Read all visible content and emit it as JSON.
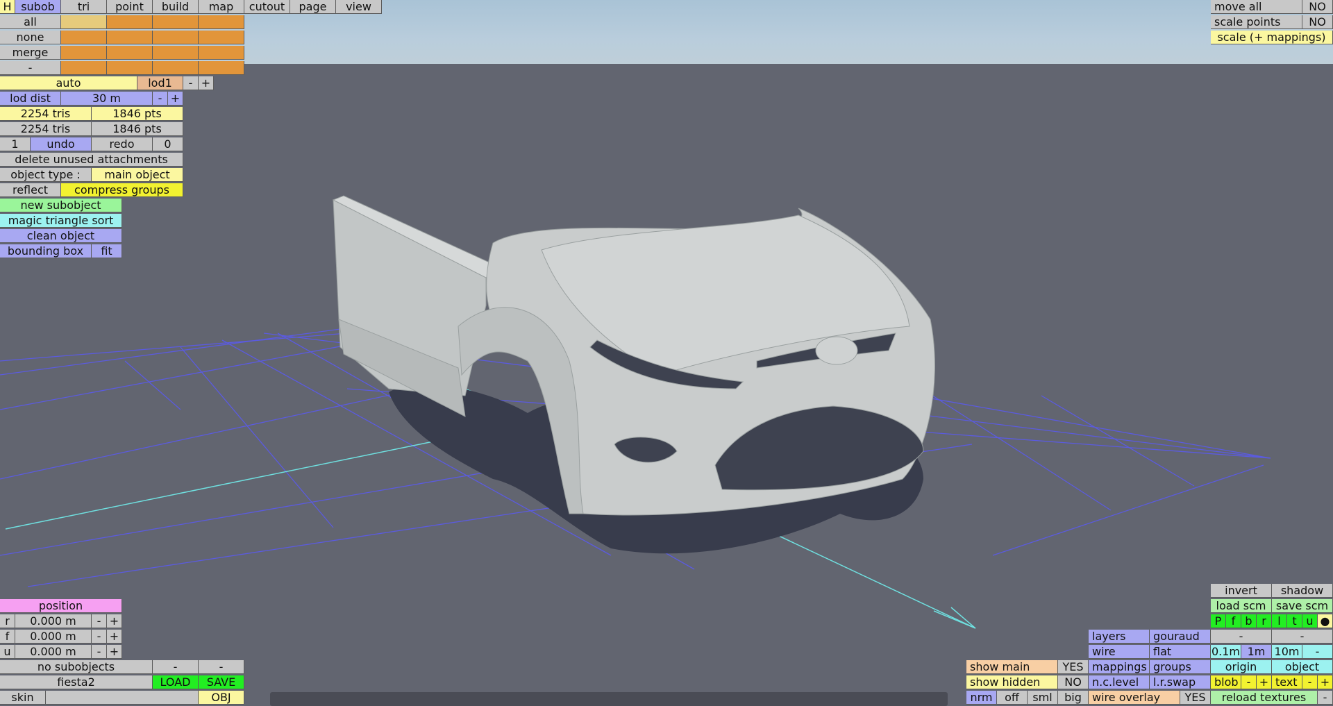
{
  "top_menu": {
    "h": "H",
    "tabs": [
      "subob",
      "tri",
      "point",
      "build",
      "map",
      "cutout",
      "page",
      "view"
    ]
  },
  "selection": {
    "all": "all",
    "none": "none",
    "merge": "merge",
    "minus": "-"
  },
  "lod": {
    "auto": "auto",
    "lod1": "lod1",
    "minus": "-",
    "plus": "+",
    "dist_label": "lod dist",
    "dist_value": "30 m"
  },
  "stats": {
    "row1_tris": "2254 tris",
    "row1_pts": "1846 pts",
    "row2_tris": "2254 tris",
    "row2_pts": "1846 pts"
  },
  "history": {
    "undo_count": "1",
    "undo": "undo",
    "redo": "redo",
    "redo_count": "0"
  },
  "object_panel": {
    "delete_unused": "delete unused attachments",
    "object_type_label": "object type :",
    "object_type_value": "main object",
    "reflect": "reflect",
    "compress_groups": "compress groups",
    "new_subobject": "new subobject",
    "magic_sort": "magic triangle sort",
    "clean_object": "clean object",
    "bounding_box": "bounding box",
    "fit": "fit"
  },
  "top_right": {
    "move_all": "move all",
    "move_all_value": "NO",
    "scale_points": "scale points",
    "scale_points_value": "NO",
    "scale_mappings": "scale (+ mappings)"
  },
  "position": {
    "title": "position",
    "rows": [
      {
        "axis": "r",
        "value": "0.000 m"
      },
      {
        "axis": "f",
        "value": "0.000 m"
      },
      {
        "axis": "u",
        "value": "0.000 m"
      }
    ],
    "minus": "-",
    "plus": "+"
  },
  "file": {
    "no_subobjects": "no subobjects",
    "dash": "-",
    "name": "fiesta2",
    "load": "LOAD",
    "save": "SAVE",
    "skin": "skin",
    "obj": "OBJ"
  },
  "view_panel": {
    "show_main": "show main",
    "show_main_value": "YES",
    "show_hidden": "show hidden",
    "show_hidden_value": "NO",
    "nrm": "nrm",
    "off": "off",
    "sml": "sml",
    "big": "big",
    "layers": "layers",
    "gouraud": "gouraud",
    "wire": "wire",
    "flat": "flat",
    "mappings": "mappings",
    "groups": "groups",
    "nc_level": "n.c.level",
    "lr_swap": "l.r.swap",
    "wire_overlay": "wire overlay",
    "wire_overlay_value": "YES"
  },
  "right_panel": {
    "invert": "invert",
    "shadow": "shadow",
    "load_scm": "load scm",
    "save_scm": "save scm",
    "view_letters": [
      "P",
      "f",
      "b",
      "r",
      "l",
      "t",
      "u",
      "●"
    ],
    "dash": "-",
    "grid_01": "0.1m",
    "grid_1": "1m",
    "grid_10": "10m",
    "origin": "origin",
    "object": "object",
    "blob": "blob",
    "text": "text",
    "minus": "-",
    "plus": "+",
    "reload_textures": "reload textures"
  },
  "colors": {
    "viewport": "#626570",
    "sky": "#b9cddc",
    "grid": "#5b5be0",
    "axis": "#6fe0e0",
    "model": "#c4c8c8",
    "shadow": "#383c4c"
  }
}
